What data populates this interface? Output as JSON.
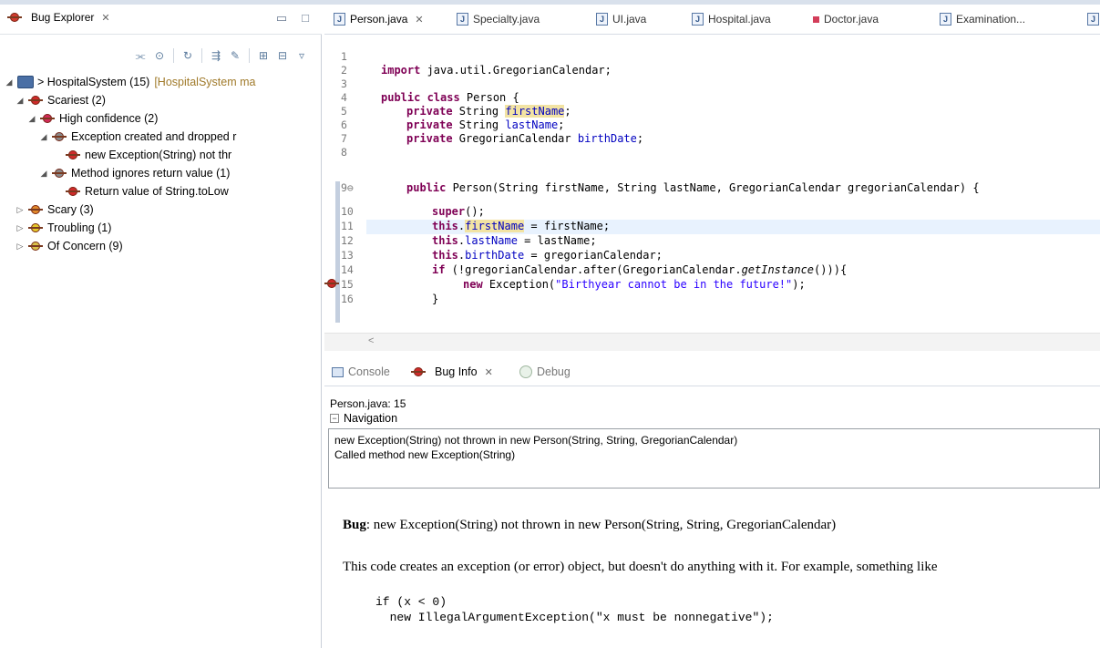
{
  "bug_explorer": {
    "title": "Bug Explorer",
    "window_buttons": [
      "▭",
      "□"
    ],
    "tree": {
      "project": "> HospitalSystem (15)",
      "project_suffix": "[HospitalSystem ma",
      "scariest": "Scariest (2)",
      "high_confidence": "High confidence (2)",
      "exception_dropped": "Exception created and dropped r",
      "new_exception": "new Exception(String) not thr",
      "ignores_return": "Method ignores return value (1)",
      "return_value": "Return value of String.toLow",
      "scary": "Scary (3)",
      "troubling": "Troubling (1)",
      "of_concern": "Of Concern (9)"
    }
  },
  "editor": {
    "tabs": [
      "Person.java",
      "Specialty.java",
      "UI.java",
      "Hospital.java",
      "Doctor.java",
      "Examination..."
    ],
    "line_numbers": [
      "1",
      "2",
      "3",
      "4",
      "5",
      "6",
      "7",
      "8",
      "9⊖",
      "10",
      "11",
      "12",
      "13",
      "14",
      "15",
      "16"
    ],
    "code": {
      "l2_import": "import",
      "l2_rest": " java.util.GregorianCalendar;",
      "l4_a": "public class",
      "l4_b": " Person {",
      "priv": "private",
      "string_type": " String ",
      "f_first": "firstName",
      "f_last": "lastName",
      "greg_type": " GregorianCalendar ",
      "f_birth": "birthDate",
      "semi": ";",
      "ctor_public": "public",
      "ctor_sig": " Person(String firstName, String lastName, GregorianCalendar gregorianCalendar) {",
      "super_kw": "super",
      "super_rest": "();",
      "this_kw": "this",
      "dot": ".",
      "assign_first": " = firstName;",
      "assign_last": " = lastName;",
      "assign_birth": " = gregorianCalendar;",
      "if_kw": "if",
      "if_a": " (!gregorianCalendar.after(GregorianCalendar.",
      "if_method": "getInstance",
      "if_b": "())){",
      "new_kw": "new",
      "new_a": " Exception(",
      "new_str": "\"Birthyear cannot be in the future!\"",
      "new_b": ");",
      "close": "}"
    }
  },
  "bottom": {
    "tabs": [
      "Console",
      "Bug Info",
      "Debug"
    ],
    "location": "Person.java: 15",
    "navigation_header": "Navigation",
    "navigation_items": [
      "new Exception(String) not thrown in new Person(String, String, GregorianCalendar)",
      "Called method new Exception(String)"
    ],
    "bug_label": "Bug",
    "bug_text": ": new Exception(String) not thrown in new Person(String, String, GregorianCalendar)",
    "description": "This code creates an exception (or error) object, but doesn't do anything with it. For example, something like",
    "example_code": "if (x < 0)\n  new IllegalArgumentException(\"x must be nonnegative\");"
  },
  "colors": {
    "keyword": "#7f0055",
    "field": "#0000c0",
    "string": "#2a00ff",
    "current_line": "#e8f2fe",
    "occurrence_mark": "#f2e3a3"
  }
}
